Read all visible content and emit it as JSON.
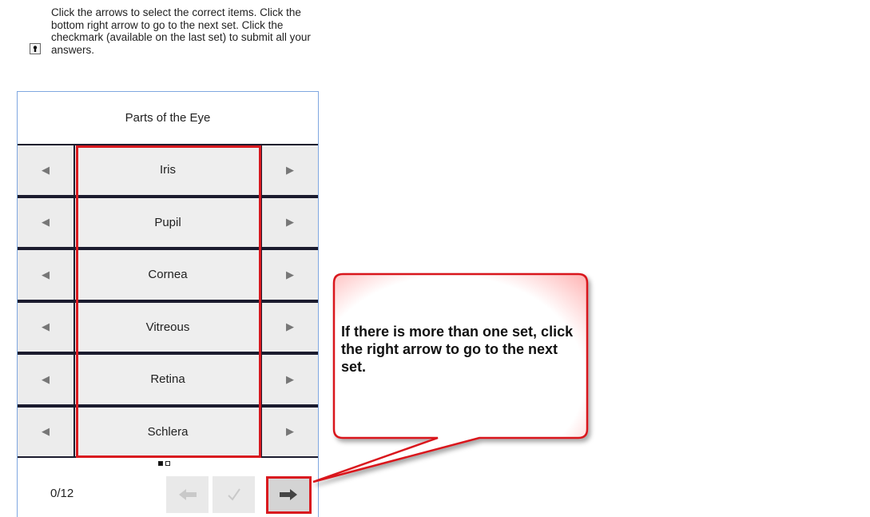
{
  "instructions": {
    "text": "Click the arrows to select the correct items. Click the bottom right arrow to go to the next set. Click the checkmark (available on the last set) to submit all your answers."
  },
  "panel": {
    "title": "Parts of the Eye",
    "items": [
      {
        "label": "Iris"
      },
      {
        "label": "Pupil"
      },
      {
        "label": "Cornea"
      },
      {
        "label": "Vitreous"
      },
      {
        "label": "Retina"
      },
      {
        "label": "Schlera"
      }
    ]
  },
  "pager": {
    "counter": "0/12",
    "dots_total": 2,
    "dots_active": 1
  },
  "callout": {
    "text": "If there is more than one set, click the right arrow to go to the next set."
  },
  "colors": {
    "highlight": "#d9191f",
    "panel_border": "#7fa7e0"
  },
  "icons": {
    "instructions": "keyhole-icon",
    "row_left": "triangle-left-icon",
    "row_right": "triangle-right-icon",
    "prev": "arrow-left-icon",
    "submit": "checkmark-icon",
    "next": "arrow-right-icon"
  }
}
